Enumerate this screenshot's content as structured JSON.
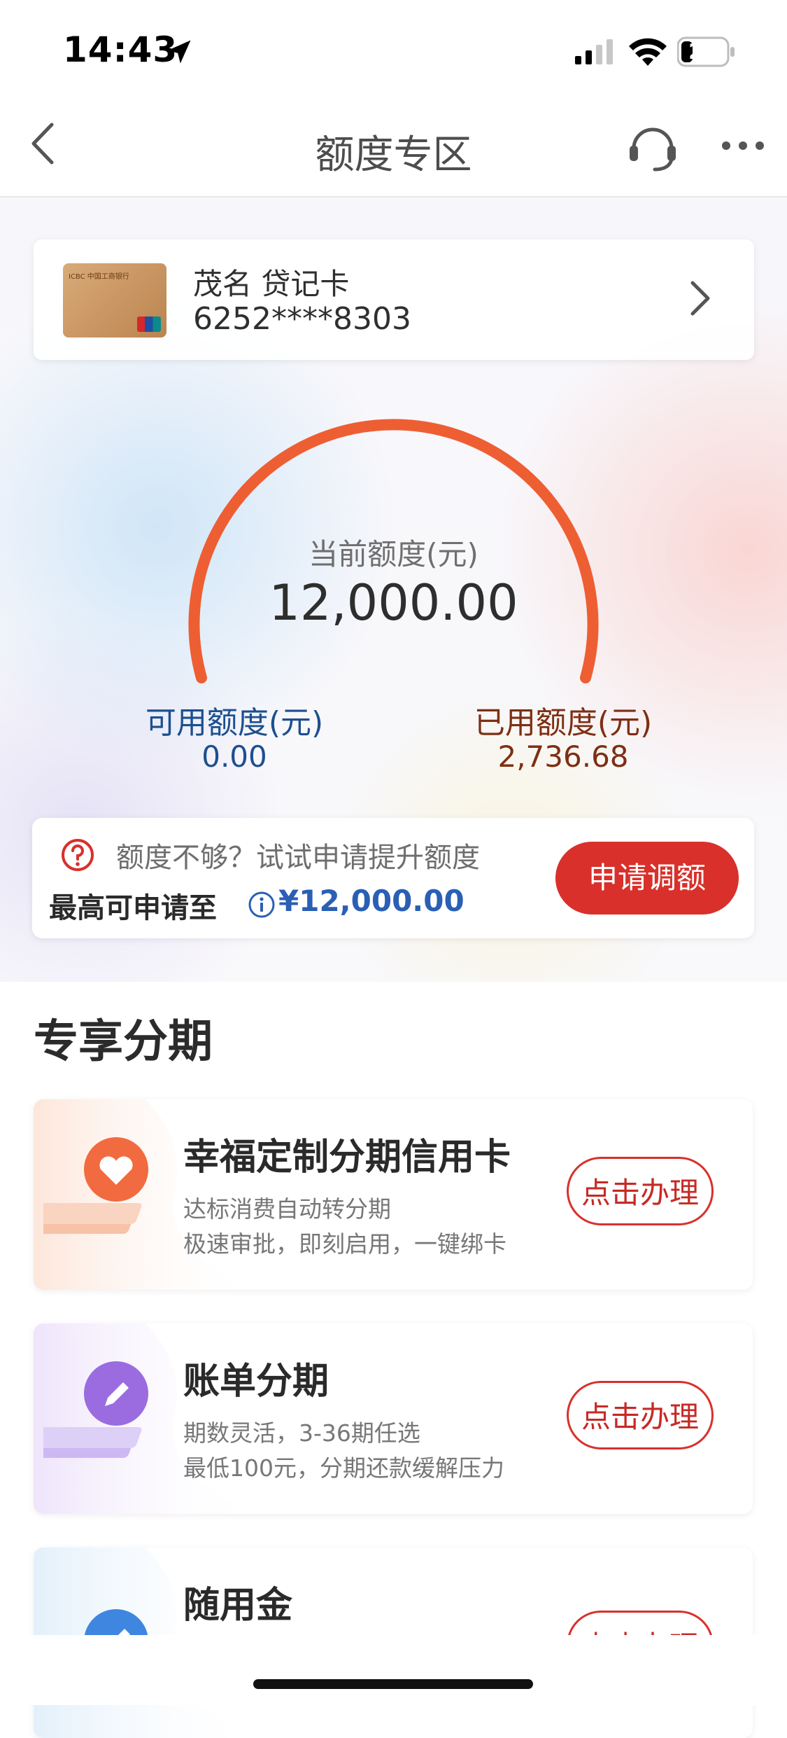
{
  "status_bar": {
    "time": "14:43",
    "battery": "21"
  },
  "nav": {
    "title": "额度专区"
  },
  "card": {
    "name": "茂名 贷记卡",
    "number": "6252****8303",
    "thumb_text": "ICBC 中国工商银行"
  },
  "limit": {
    "current_label": "当前额度(元)",
    "current_value": "12,000.00",
    "available_label": "可用额度(元)",
    "available_value": "0.00",
    "used_label": "已用额度(元)",
    "used_value": "2,736.68"
  },
  "raise": {
    "hint": "额度不够？试试申请提升额度",
    "max_label": "最高可申请至",
    "max_value": "¥12,000.00",
    "button": "申请调额"
  },
  "section": {
    "title": "专享分期"
  },
  "promos": [
    {
      "title": "幸福定制分期信用卡",
      "desc1": "达标消费自动转分期",
      "desc2": "极速审批，即刻启用，一键绑卡",
      "button": "点击办理"
    },
    {
      "title": "账单分期",
      "desc1": "期数灵活，3-36期任选",
      "desc2": "最低100元，分期还款缓解压力",
      "button": "点击办理"
    },
    {
      "title": "随用金",
      "button": "点击办理"
    }
  ],
  "colors": {
    "accent_red": "#d9302b",
    "gauge_orange": "#ee5e33",
    "available_blue": "#1e4f8f",
    "used_brown": "#7e2f14"
  }
}
